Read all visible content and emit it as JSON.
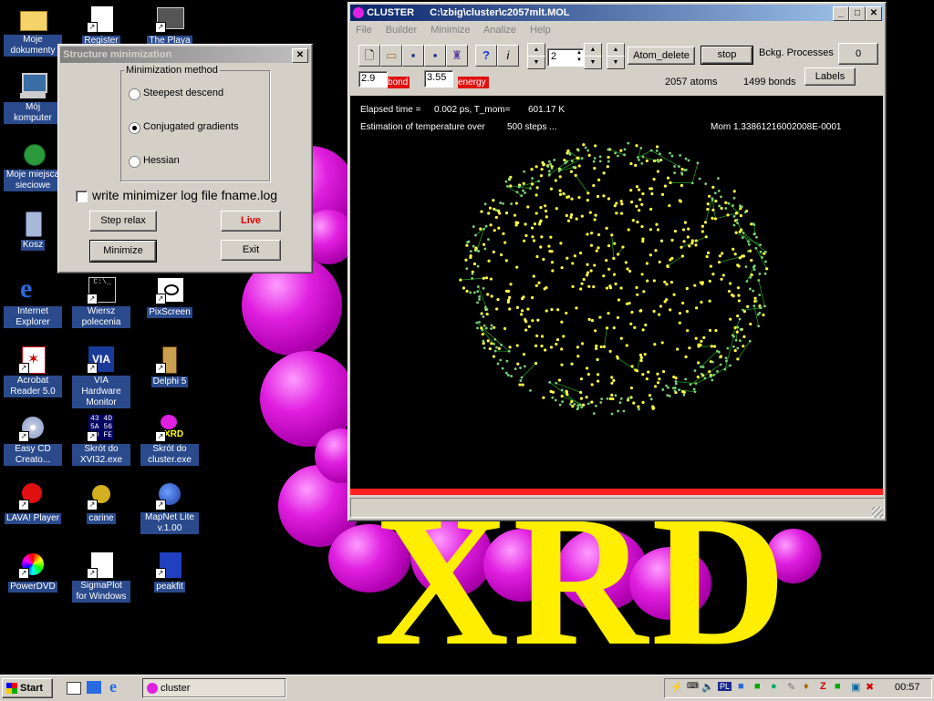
{
  "desktop": {
    "icons": [
      {
        "label": "Moje dokumenty",
        "icon": "folder-icon"
      },
      {
        "label": "Register",
        "icon": "register-icon"
      },
      {
        "label": "The Playa",
        "icon": "playa-icon"
      },
      {
        "label": "Mój komputer",
        "icon": "computer-icon"
      },
      {
        "label": "Moje miejsca sieciowe",
        "icon": "network-icon"
      },
      {
        "label": "Kosz",
        "icon": "recycle-bin-icon"
      },
      {
        "label": "Internet Explorer",
        "icon": "ie-icon"
      },
      {
        "label": "Wiersz polecenia",
        "icon": "cmd-icon"
      },
      {
        "label": "PixScreen",
        "icon": "pixscreen-icon"
      },
      {
        "label": "Acrobat Reader 5.0",
        "icon": "acrobat-icon"
      },
      {
        "label": "VIA Hardware Monitor",
        "icon": "via-icon"
      },
      {
        "label": "Delphi 5",
        "icon": "delphi-icon"
      },
      {
        "label": "Easy CD Creato...",
        "icon": "cd-icon"
      },
      {
        "label": "Skrót do XVI32.exe",
        "icon": "hex-icon"
      },
      {
        "label": "Skrót do cluster.exe",
        "icon": "xrd-icon"
      },
      {
        "label": "LAVA! Player",
        "icon": "mp3-icon"
      },
      {
        "label": "carine",
        "icon": "carine-icon"
      },
      {
        "label": "MapNet Lite v.1.00",
        "icon": "globe-icon"
      },
      {
        "label": "PowerDVD",
        "icon": "dvd-icon"
      },
      {
        "label": "SigmaPlot for Windows",
        "icon": "sigmaplot-icon"
      },
      {
        "label": "peakfit",
        "icon": "peakfit-icon"
      }
    ],
    "wallpaper_text": "XRD"
  },
  "minimize_dialog": {
    "title": "Structure minimization",
    "group_label": "Minimization method",
    "methods": [
      "Steepest descend",
      "Conjugated gradients",
      "Hessian"
    ],
    "selected_method": "Conjugated gradients",
    "log_checkbox_label": "write minimizer log  file fname.log",
    "log_checked": false,
    "buttons": {
      "step_relax": "Step relax",
      "live": "Live",
      "minimize": "Minimize",
      "exit": "Exit"
    }
  },
  "cluster_window": {
    "title": "CLUSTER",
    "path": "C:\\zbig\\cluster\\c2057mlt.MOL",
    "menu": [
      "File",
      "Builder",
      "Minimize",
      "Analize",
      "Help"
    ],
    "toolbar": {
      "spin_value": "2",
      "atom_delete": "Atom_delete",
      "stop": "stop",
      "bckg_processes_label": "Bckg. Processes",
      "bckg_processes_value": "0",
      "labels_button": "Labels"
    },
    "bond_value": "2.9",
    "bond_label": "bond",
    "energy_value": "3.55",
    "energy_label": "energy",
    "atoms": "2057 atoms",
    "bonds": "1499 bonds",
    "canvas": {
      "elapsed_label": "Elapsed time =",
      "elapsed_value": "0.002 ps, T_mom=",
      "temperature": "601.17 K",
      "estimation": "Estimation of temperature over",
      "steps": "500 steps ...",
      "mom": "Mom  1.33861216002008E-0001"
    },
    "colors": {
      "atoms": "#ffff40",
      "bonds": "#22aa22",
      "bar": "#ff2020"
    }
  },
  "taskbar": {
    "start": "Start",
    "task": "cluster",
    "clock": "00:57",
    "tray_lang": "PL"
  }
}
